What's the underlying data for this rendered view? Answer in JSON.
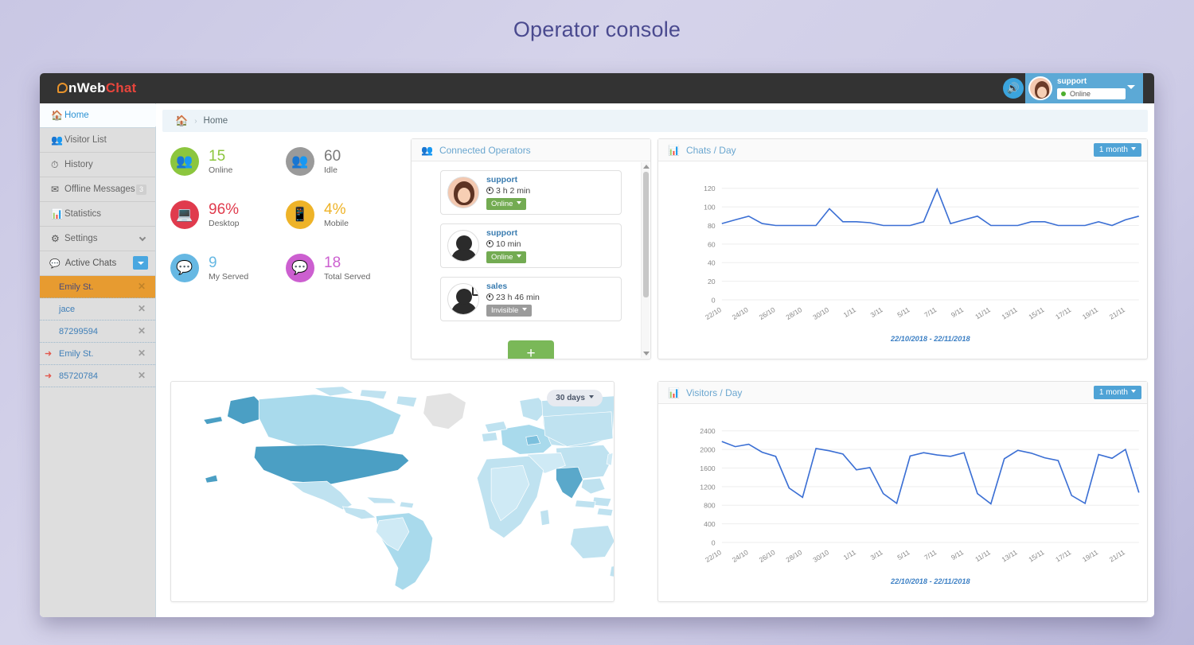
{
  "page": {
    "title": "Operator console"
  },
  "app": {
    "logo": {
      "prefix": "n",
      "mid": "Web",
      "suffix": "Chat"
    },
    "speaker_icon": "speaker-icon",
    "user": {
      "name": "support",
      "status": "Online"
    }
  },
  "sidebar": {
    "items": [
      {
        "label": "Home",
        "icon": "home-icon",
        "active": true
      },
      {
        "label": "Visitor List",
        "icon": "users-icon",
        "active": false
      },
      {
        "label": "History",
        "icon": "clock-icon",
        "active": false
      },
      {
        "label": "Offline Messages",
        "icon": "envelope-icon",
        "badge": "3",
        "active": false
      },
      {
        "label": "Statistics",
        "icon": "bar-chart-icon",
        "active": false
      },
      {
        "label": "Settings",
        "icon": "gear-icon",
        "chevron": true,
        "active": false
      }
    ],
    "active_chats": {
      "label": "Active Chats",
      "icon": "chat-bubble-icon",
      "items": [
        {
          "label": "Emily St.",
          "selected": true,
          "leave": false
        },
        {
          "label": "jace",
          "selected": false,
          "leave": false
        },
        {
          "label": "87299594",
          "selected": false,
          "leave": false
        },
        {
          "label": "Emily St.",
          "selected": false,
          "leave": true
        },
        {
          "label": "85720784",
          "selected": false,
          "leave": true
        }
      ]
    }
  },
  "breadcrumb": {
    "home_icon": "home-icon",
    "separator": "›",
    "current": "Home"
  },
  "tiles": [
    {
      "value": "15",
      "label": "Online",
      "icon": "users-icon",
      "color": "#8cc63e"
    },
    {
      "value": "60",
      "label": "Idle",
      "icon": "users-icon",
      "color": "#9a9a9a"
    },
    {
      "value": "96%",
      "label": "Desktop",
      "icon": "monitor-icon",
      "color": "#e03b4d"
    },
    {
      "value": "4%",
      "label": "Mobile",
      "icon": "mobile-icon",
      "color": "#eeb328"
    },
    {
      "value": "9",
      "label": "My Served",
      "icon": "chat-bubble-icon",
      "color": "#66b8e3"
    },
    {
      "value": "18",
      "label": "Total Served",
      "icon": "chat-bubble-icon",
      "color": "#cc5fd0"
    }
  ],
  "operators_panel": {
    "title": "Connected Operators",
    "icon": "users-icon",
    "add_button": "+",
    "operators": [
      {
        "name": "support",
        "time": "3 h  2 min",
        "status": "Online",
        "status_color": "#73ab52",
        "avatar": "photo",
        "mobile": false
      },
      {
        "name": "support",
        "time": "10 min",
        "status": "Online",
        "status_color": "#73ab52",
        "avatar": "silhouette",
        "mobile": false
      },
      {
        "name": "sales",
        "time": "23 h 46 min",
        "status": "Invisible",
        "status_color": "#9b9b9b",
        "avatar": "silhouette",
        "mobile": true
      }
    ]
  },
  "map_panel": {
    "range_label": "30 days"
  },
  "chart_data": [
    {
      "id": "chats",
      "type": "line",
      "title": "Chats / Day",
      "icon": "bar-chart-icon",
      "range_label": "1 month",
      "subtitle": "22/10/2018 - 22/11/2018",
      "xlabel": "",
      "ylabel": "",
      "ylim": [
        0,
        130
      ],
      "yticks": [
        0,
        20,
        40,
        60,
        80,
        100,
        120
      ],
      "grid": true,
      "legend": "none",
      "categories": [
        "22/10",
        "23/10",
        "24/10",
        "25/10",
        "26/10",
        "27/10",
        "28/10",
        "29/10",
        "30/10",
        "31/10",
        "1/11",
        "2/11",
        "3/11",
        "4/11",
        "5/11",
        "6/11",
        "7/11",
        "8/11",
        "9/11",
        "10/11",
        "11/11",
        "12/11",
        "13/11",
        "14/11",
        "15/11",
        "16/11",
        "17/11",
        "18/11",
        "19/11",
        "20/11",
        "21/11",
        "22/11"
      ],
      "tick_labels": [
        "22/10",
        "24/10",
        "26/10",
        "28/10",
        "30/10",
        "1/11",
        "3/11",
        "5/11",
        "7/11",
        "9/11",
        "11/11",
        "13/11",
        "15/11",
        "17/11",
        "19/11",
        "21/11"
      ],
      "values": [
        82,
        86,
        90,
        82,
        80,
        80,
        80,
        80,
        98,
        84,
        84,
        83,
        80,
        80,
        80,
        84,
        119,
        82,
        86,
        90,
        80,
        80,
        80,
        84,
        84,
        80,
        80,
        80,
        84,
        80,
        86,
        90
      ]
    },
    {
      "id": "visitors",
      "type": "line",
      "title": "Visitors / Day",
      "icon": "bar-chart-icon",
      "range_label": "1 month",
      "subtitle": "22/10/2018 - 22/11/2018",
      "xlabel": "",
      "ylabel": "",
      "ylim": [
        0,
        2600
      ],
      "yticks": [
        0,
        400,
        800,
        1200,
        1600,
        2000,
        2400
      ],
      "grid": true,
      "legend": "none",
      "categories": [
        "22/10",
        "23/10",
        "24/10",
        "25/10",
        "26/10",
        "27/10",
        "28/10",
        "29/10",
        "30/10",
        "31/10",
        "1/11",
        "2/11",
        "3/11",
        "4/11",
        "5/11",
        "6/11",
        "7/11",
        "8/11",
        "9/11",
        "10/11",
        "11/11",
        "12/11",
        "13/11",
        "14/11",
        "15/11",
        "16/11",
        "17/11",
        "18/11",
        "19/11",
        "20/11",
        "21/11",
        "22/11"
      ],
      "tick_labels": [
        "22/10",
        "24/10",
        "26/10",
        "28/10",
        "30/10",
        "1/11",
        "3/11",
        "5/11",
        "7/11",
        "9/11",
        "11/11",
        "13/11",
        "15/11",
        "17/11",
        "19/11",
        "21/11"
      ],
      "values": [
        2170,
        2060,
        2110,
        1940,
        1850,
        1170,
        970,
        2020,
        1970,
        1900,
        1560,
        1610,
        1050,
        840,
        1860,
        1930,
        1880,
        1850,
        1930,
        1050,
        830,
        1800,
        1980,
        1920,
        1820,
        1760,
        1010,
        840,
        1890,
        1810,
        2000,
        1070
      ]
    }
  ]
}
